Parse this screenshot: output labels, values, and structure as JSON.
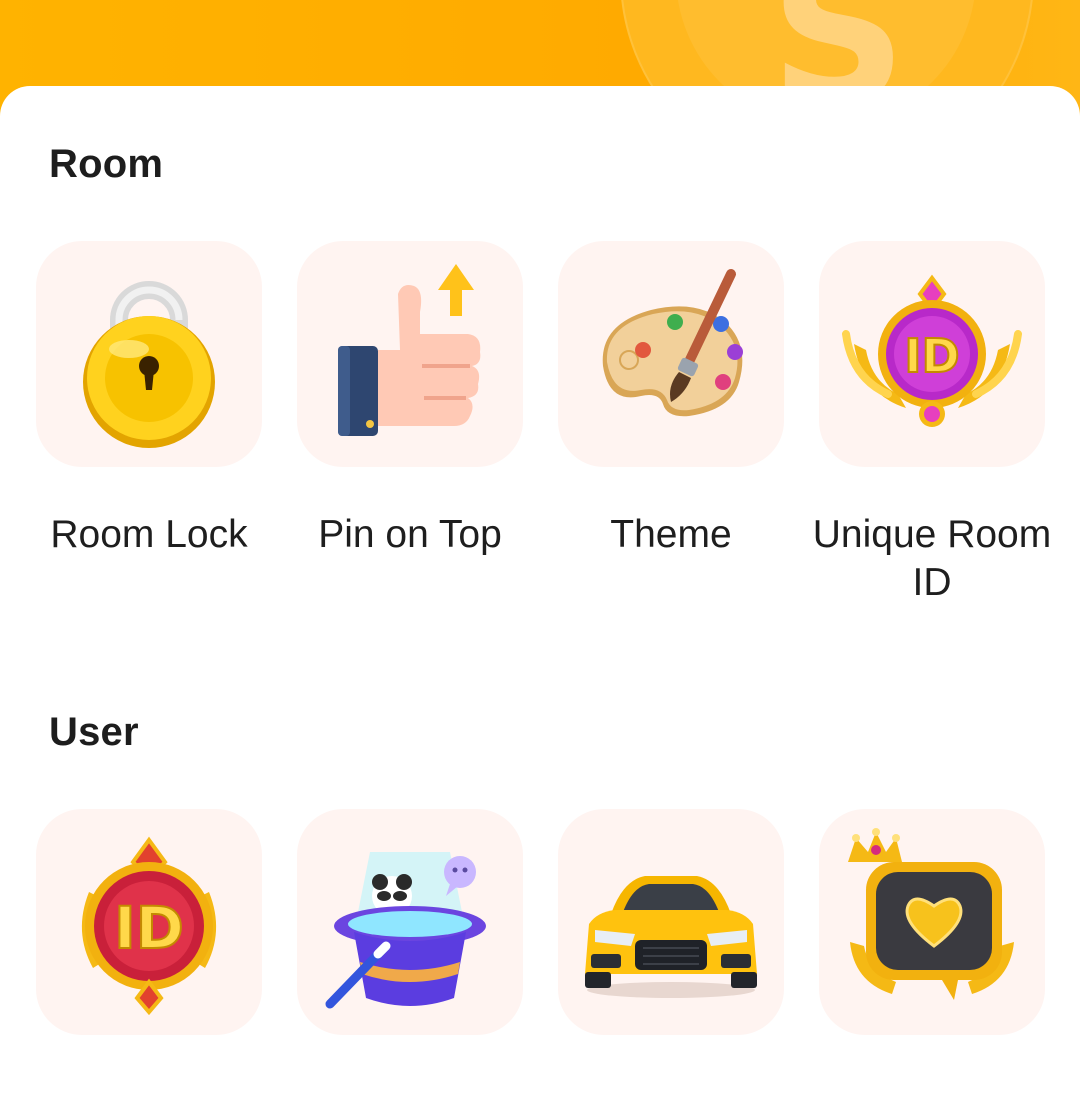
{
  "banner": {
    "badge_letter": "S",
    "accent": "#FFB000"
  },
  "sections": [
    {
      "title": "Room",
      "items": [
        {
          "label": "Room Lock",
          "icon": "padlock-icon"
        },
        {
          "label": "Pin on Top",
          "icon": "thumbs-up-arrow-icon"
        },
        {
          "label": "Theme",
          "icon": "paint-palette-icon"
        },
        {
          "label": "Unique Room ID",
          "icon": "purple-id-badge-icon"
        }
      ]
    },
    {
      "title": "User",
      "items": [
        {
          "label": "",
          "icon": "red-id-badge-icon"
        },
        {
          "label": "",
          "icon": "magic-hat-icon"
        },
        {
          "label": "",
          "icon": "sports-car-icon"
        },
        {
          "label": "",
          "icon": "crown-chat-frame-icon"
        }
      ]
    }
  ],
  "colors": {
    "tile_bg": "#FFF4F1",
    "text": "#1E1E1E"
  }
}
